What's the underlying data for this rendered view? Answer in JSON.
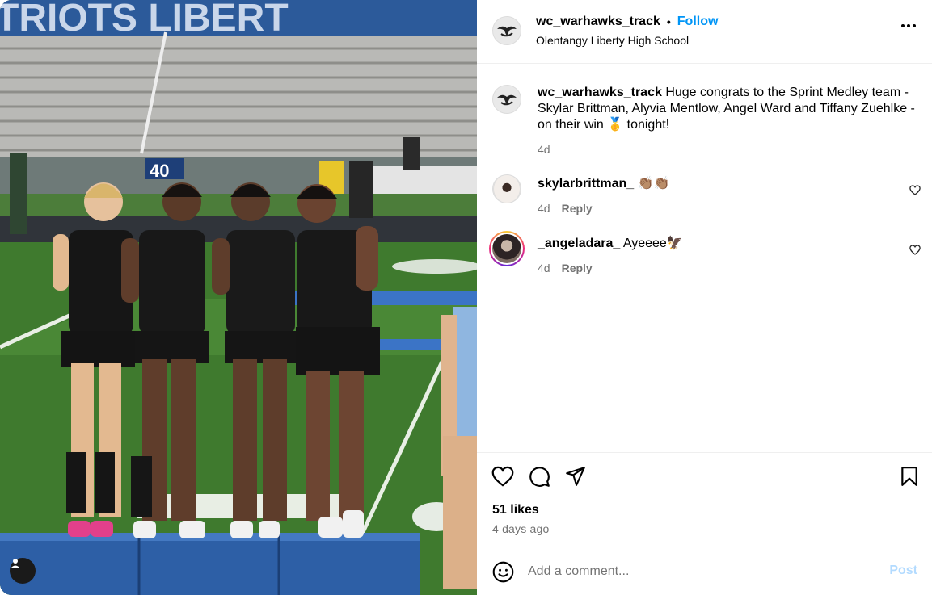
{
  "post": {
    "author": "wc_warhawks_track",
    "follow_label": "Follow",
    "separator": "•",
    "location": "Olentangy Liberty High School",
    "caption_user": "wc_warhawks_track",
    "caption_text": "Huge congrats to the Sprint Medley team - Skylar Brittman, Alyvia Mentlow, Angel Ward and Tiffany Zuehlke - on their win 🥇 tonight!",
    "caption_time": "4d"
  },
  "photo": {
    "banner_text": "TRIOTS   LIBERT",
    "sign_number": "40",
    "user_tag_icon": "person-icon"
  },
  "comments": [
    {
      "user": "skylarbrittman_",
      "text": "👏🏽👏🏽",
      "time": "4d",
      "reply": "Reply"
    },
    {
      "user": "_angeladara_",
      "text": "Ayeeee🦅",
      "time": "4d",
      "reply": "Reply"
    }
  ],
  "actions": {
    "likes": "51 likes",
    "ago": "4 days ago",
    "icons": [
      "heart-icon",
      "comment-icon",
      "share-icon",
      "bookmark-icon"
    ]
  },
  "composer": {
    "placeholder": "Add a comment...",
    "post_label": "Post"
  },
  "colors": {
    "accent": "#0095f6",
    "muted": "#737373",
    "post_disabled": "#b3dbff"
  }
}
